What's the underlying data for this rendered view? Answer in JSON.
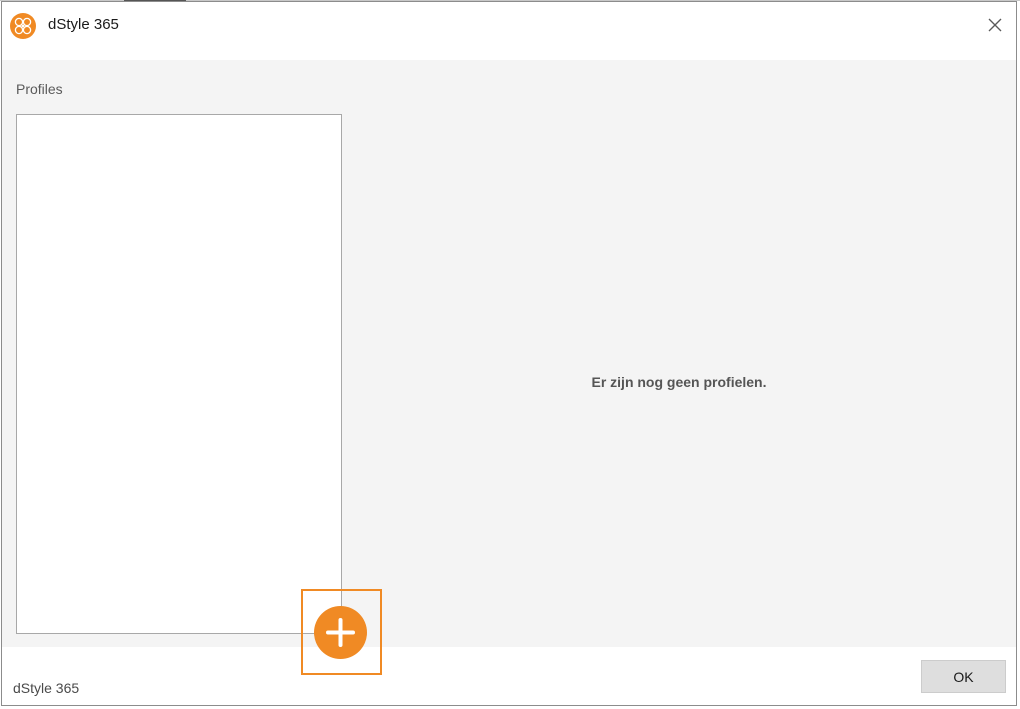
{
  "window": {
    "title": "dStyle 365",
    "logo_icon": "dstyle-logo-icon",
    "close_icon": "close-icon"
  },
  "profiles": {
    "label": "Profiles",
    "items": [],
    "empty_message": "Er zijn nog geen profielen."
  },
  "add_button": {
    "icon": "plus-icon"
  },
  "footer": {
    "app_name": "dStyle 365",
    "ok_label": "OK"
  },
  "colors": {
    "accent": "#f08a24",
    "content_bg": "#f4f4f4",
    "button_bg": "#dedede"
  }
}
